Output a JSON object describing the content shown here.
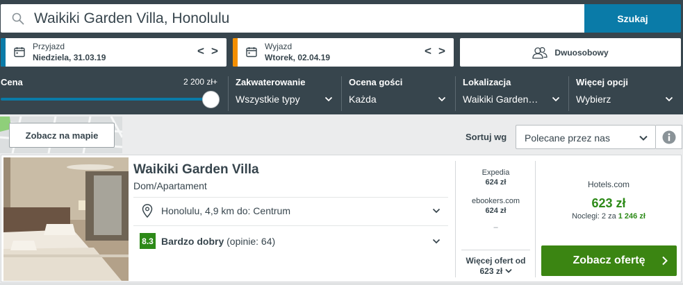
{
  "search": {
    "query": "Waikiki Garden Villa, Honolulu",
    "button_label": "Szukaj"
  },
  "dates": {
    "checkin_label": "Przyjazd",
    "checkin_value": "Niedziela, 31.03.19",
    "checkout_label": "Wyjazd",
    "checkout_value": "Wtorek, 02.04.19",
    "prev_arrow": "<",
    "next_arrow": ">"
  },
  "guests": {
    "label": "Dwuosobowy"
  },
  "filters": {
    "price_label": "Cena",
    "price_max": "2 200 zł+",
    "price_slider_fraction": 1.0,
    "accommodation_label": "Zakwaterowanie",
    "accommodation_value": "Wszystkie typy",
    "rating_label": "Ocena gości",
    "rating_value": "Każda",
    "location_label": "Lokalizacja",
    "location_value": "Waikiki Garden…",
    "more_label": "Więcej opcji",
    "more_value": "Wybierz"
  },
  "map": {
    "button_label": "Zobacz na mapie"
  },
  "sort": {
    "label": "Sortuj wg",
    "selected": "Polecane przez nas"
  },
  "hotel": {
    "name": "Waikiki Garden Villa",
    "type": "Dom/Apartament",
    "location": "Honolulu, 4,9 km do: Centrum",
    "rating_score": "8.3",
    "rating_text": "Bardzo dobry",
    "rating_reviews": "(opinie: 64)"
  },
  "offers": [
    {
      "provider": "Expedia",
      "price": "624 zł"
    },
    {
      "provider": "ebookers.com",
      "price": "624 zł"
    },
    {
      "provider": "",
      "price": "–"
    }
  ],
  "more_offers": {
    "label": "Więcej ofert od",
    "price": "623 zł"
  },
  "best_deal": {
    "provider": "Hotels.com",
    "price": "623 zł",
    "nights_label": "Noclegi: 2 za",
    "nights_total": "1 246 zł",
    "button_label": "Zobacz ofertę"
  },
  "colors": {
    "header_bg": "#37454d",
    "accent_blue": "#0a7ba8",
    "checkin_bar": "#0a7ba8",
    "checkout_bar": "#f48f00",
    "deal_green": "#3b8512",
    "price_green": "#2d8a18"
  },
  "icons": {
    "search": "search-icon",
    "calendar": "calendar-icon",
    "guests": "guests-icon",
    "chevron": "chevron-down-icon",
    "info": "info-icon",
    "pin": "location-pin-icon",
    "arrow": "chevron-right-icon"
  }
}
